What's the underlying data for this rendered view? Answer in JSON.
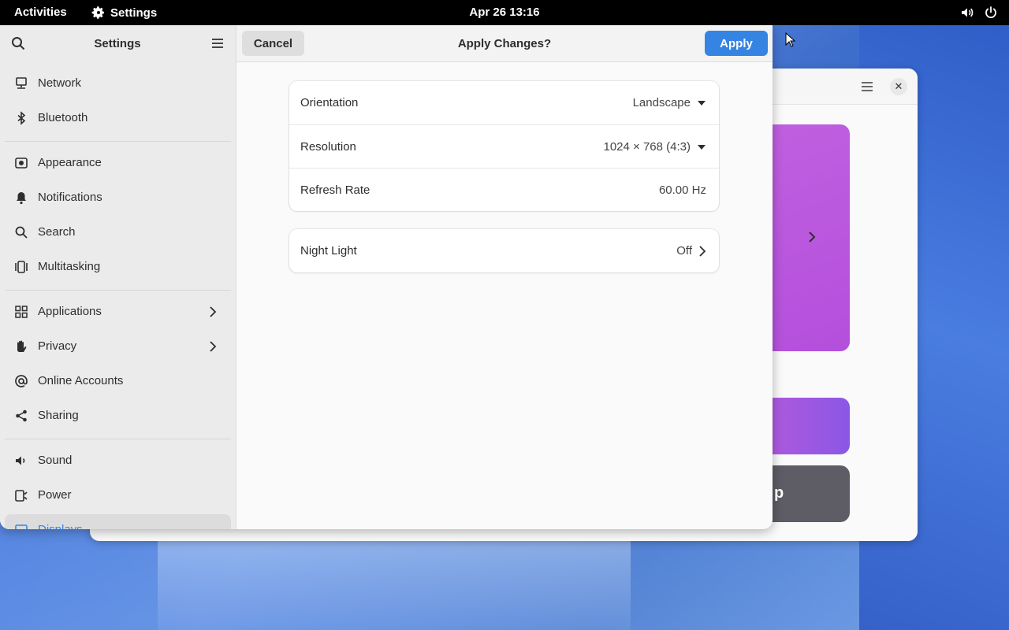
{
  "topbar": {
    "activities": "Activities",
    "app_name": "Settings",
    "clock": "Apr 26  13:16",
    "icons": [
      "volume-icon",
      "power-icon"
    ]
  },
  "background_window": {
    "card_text": "p",
    "colors": {
      "card1": "#b44fdc",
      "card2_start": "#c85bd6",
      "card2_end": "#8a57e6",
      "card3": "#5e5c64"
    }
  },
  "sidebar": {
    "title": "Settings",
    "items": [
      {
        "label": "Network",
        "icon": "network-icon"
      },
      {
        "label": "Bluetooth",
        "icon": "bluetooth-icon"
      },
      {
        "label": "Appearance",
        "icon": "appearance-icon"
      },
      {
        "label": "Notifications",
        "icon": "bell-icon"
      },
      {
        "label": "Search",
        "icon": "search-icon"
      },
      {
        "label": "Multitasking",
        "icon": "multitasking-icon"
      },
      {
        "label": "Applications",
        "icon": "apps-grid-icon"
      },
      {
        "label": "Privacy",
        "icon": "hand-icon"
      },
      {
        "label": "Online Accounts",
        "icon": "at-icon"
      },
      {
        "label": "Sharing",
        "icon": "share-icon"
      },
      {
        "label": "Sound",
        "icon": "speaker-icon"
      },
      {
        "label": "Power",
        "icon": "power-plug-icon"
      },
      {
        "label": "Displays",
        "icon": "display-icon"
      }
    ]
  },
  "header": {
    "cancel_label": "Cancel",
    "title": "Apply Changes?",
    "apply_label": "Apply"
  },
  "display": {
    "orientation_label": "Orientation",
    "orientation_value": "Landscape",
    "resolution_label": "Resolution",
    "resolution_value": "1024 × 768 (4:3)",
    "refresh_label": "Refresh Rate",
    "refresh_value": "60.00 Hz",
    "night_light_label": "Night Light",
    "night_light_value": "Off"
  },
  "colors": {
    "accent": "#3584e4",
    "topbar": "#000000"
  }
}
